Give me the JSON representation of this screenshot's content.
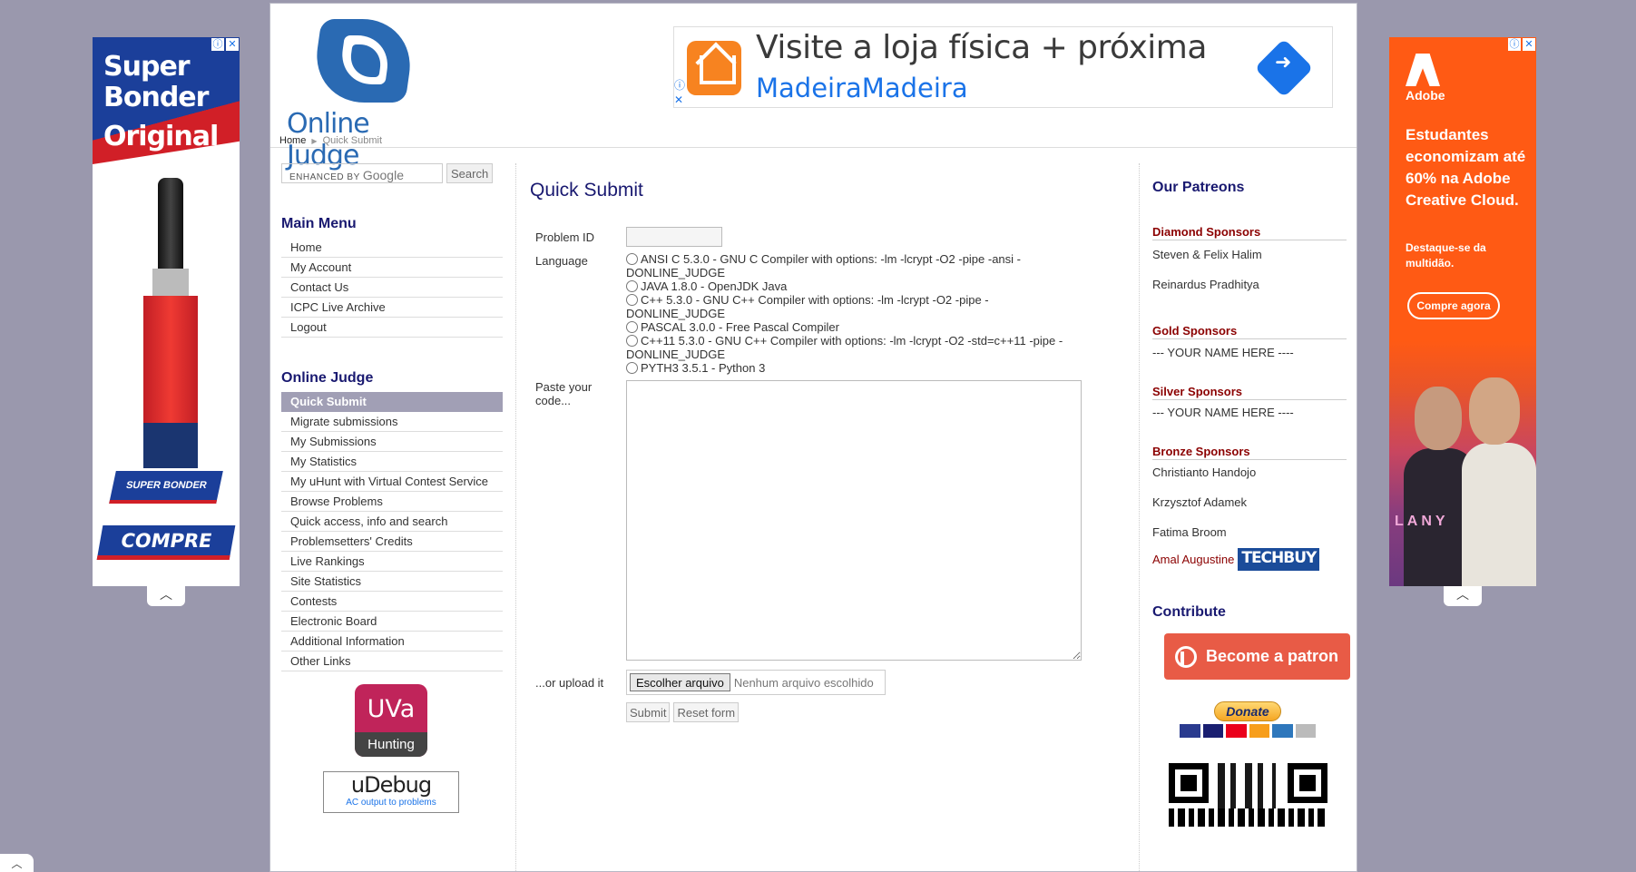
{
  "left_ad": {
    "headline_line1": "Super",
    "headline_line2": "Bonder",
    "headline_line3": "Original",
    "badge": "SUPER BONDER LOCTITE",
    "cta": "COMPRE"
  },
  "right_ad": {
    "brand": "Adobe",
    "headline": "Estudantes economizam até 60% na Adobe Creative Cloud.",
    "subtext": "Destaque-se da multidão.",
    "cta": "Compre agora",
    "artist": "LANY"
  },
  "header": {
    "logo_text": "Online Judge",
    "breadcrumb": {
      "home": "Home",
      "current": "Quick Submit"
    }
  },
  "banner_ad": {
    "line1": "Visite a loja física + próxima",
    "line2": "MadeiraMadeira"
  },
  "search": {
    "placeholder": "ENHANCED BY",
    "brand": "Google",
    "button_label": "Search"
  },
  "main_menu": {
    "title": "Main Menu",
    "items": [
      "Home",
      "My Account",
      "Contact Us",
      "ICPC Live Archive",
      "Logout"
    ]
  },
  "oj_menu": {
    "title": "Online Judge",
    "items": [
      "Quick Submit",
      "Migrate submissions",
      "My Submissions",
      "My Statistics",
      "My uHunt with Virtual Contest Service",
      "Browse Problems",
      "Quick access, info and search",
      "Problemsetters' Credits",
      "Live Rankings",
      "Site Statistics",
      "Contests",
      "Electronic Board",
      "Additional Information",
      "Other Links"
    ],
    "active_index": 0
  },
  "uva_logo": {
    "top": "UVa",
    "bottom": "Hunting"
  },
  "udebug": {
    "title": "uDebug",
    "subtitle": "AC output to problems"
  },
  "form": {
    "title": "Quick Submit",
    "problem_id_label": "Problem ID",
    "problem_id_value": "",
    "language_label": "Language",
    "languages": [
      "ANSI C 5.3.0 - GNU C Compiler with options: -lm -lcrypt -O2 -pipe -ansi -DONLINE_JUDGE",
      "JAVA 1.8.0 - OpenJDK Java",
      "C++ 5.3.0 - GNU C++ Compiler with options: -lm -lcrypt -O2 -pipe -DONLINE_JUDGE",
      "PASCAL 3.0.0 - Free Pascal Compiler",
      "C++11 5.3.0 - GNU C++ Compiler with options: -lm -lcrypt -O2 -std=c++11 -pipe -DONLINE_JUDGE",
      "PYTH3 3.5.1 - Python 3"
    ],
    "code_label": "Paste your code...",
    "upload_label": "...or upload it",
    "file_button": "Escolher arquivo",
    "file_status": "Nenhum arquivo escolhido",
    "submit_label": "Submit",
    "reset_label": "Reset form"
  },
  "patreons": {
    "title": "Our Patreons",
    "diamond_title": "Diamond Sponsors",
    "diamond": [
      "Steven & Felix Halim",
      "Reinardus Pradhitya"
    ],
    "gold_title": "Gold Sponsors",
    "gold": [
      "--- YOUR NAME HERE ----"
    ],
    "silver_title": "Silver Sponsors",
    "silver": [
      "--- YOUR NAME HERE ----"
    ],
    "bronze_title": "Bronze Sponsors",
    "bronze": [
      "Christianto Handojo",
      "Krzysztof Adamek",
      "Fatima Broom"
    ],
    "featured_name": "Amal Augustine",
    "featured_logo": "TECHBUY"
  },
  "contribute": {
    "title": "Contribute",
    "patron_button": "Become a patron",
    "donate_button": "Donate"
  }
}
